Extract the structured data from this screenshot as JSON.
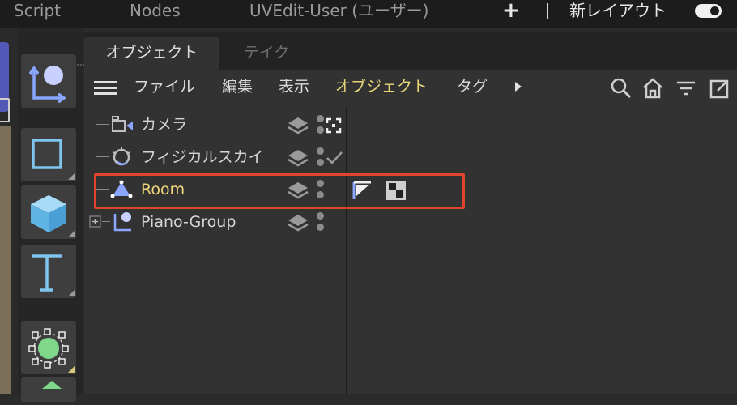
{
  "topbar": {
    "items": [
      "Script",
      "Nodes",
      "UVEdit-User (ユーザー)"
    ],
    "add_label": "+",
    "layout_label": "新レイアウト"
  },
  "tabs": [
    {
      "label": "オブジェクト",
      "active": true
    },
    {
      "label": "テイク",
      "active": false
    }
  ],
  "menu": {
    "items": [
      "ファイル",
      "編集",
      "表示",
      "オブジェクト",
      "タグ"
    ],
    "highlighted": "オブジェクト"
  },
  "objects": [
    {
      "name": "カメラ",
      "icon": "camera-icon",
      "status": "focus-target-icon"
    },
    {
      "name": "フィジカルスカイ",
      "icon": "physical-sky-icon",
      "status": "check-icon"
    },
    {
      "name": "Room",
      "icon": "polygon-object-icon",
      "selected": true,
      "tags": [
        "phong-tag-icon",
        "material-tag-icon"
      ]
    },
    {
      "name": "Piano-Group",
      "icon": "null-group-icon",
      "collapsed": true
    }
  ],
  "colors": {
    "accent_yellow": "#e8d67a",
    "highlight_box": "#e0442c",
    "icon_blue": "#8aa6ff"
  }
}
